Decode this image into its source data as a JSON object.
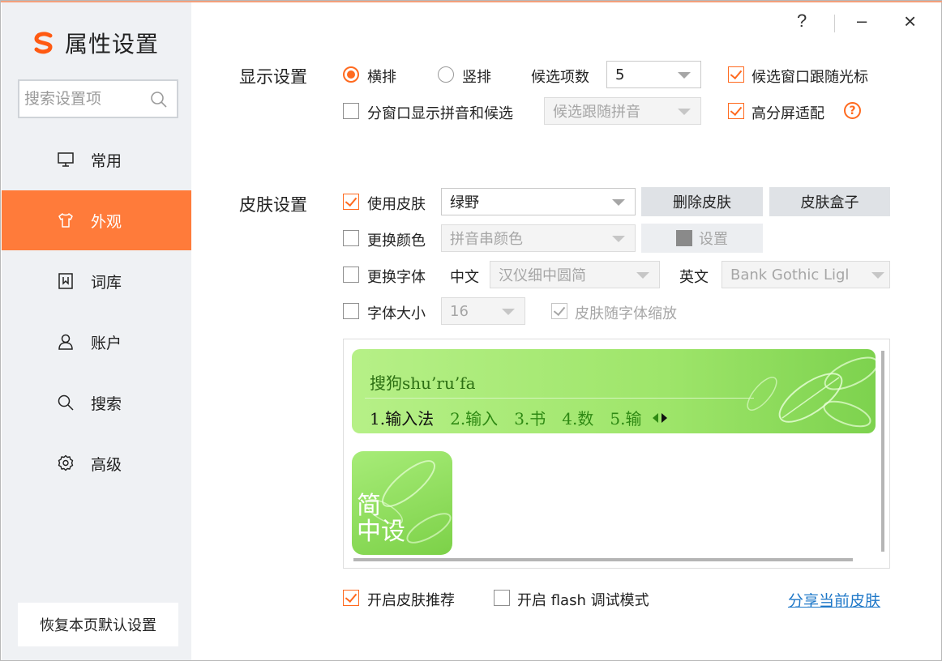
{
  "window": {
    "title": "属性设置",
    "controls": {
      "help": "?",
      "minimize": "–",
      "close": "×"
    }
  },
  "sidebar": {
    "search_placeholder": "搜索设置项",
    "items": [
      {
        "label": "常用",
        "icon": "monitor-icon",
        "active": false
      },
      {
        "label": "外观",
        "icon": "shirt-icon",
        "active": true
      },
      {
        "label": "词库",
        "icon": "dictionary-icon",
        "active": false
      },
      {
        "label": "账户",
        "icon": "user-icon",
        "active": false
      },
      {
        "label": "搜索",
        "icon": "search-icon",
        "active": false
      },
      {
        "label": "高级",
        "icon": "gear-icon",
        "active": false
      }
    ],
    "reset_label": "恢复本页默认设置"
  },
  "display": {
    "section_label": "显示设置",
    "horizontal_label": "横排",
    "horizontal_selected": true,
    "vertical_label": "竖排",
    "vertical_selected": false,
    "candidate_count_label": "候选项数",
    "candidate_count_value": "5",
    "follow_cursor_label": "候选窗口跟随光标",
    "follow_cursor_checked": true,
    "split_window_label": "分窗口显示拼音和候选",
    "split_window_checked": false,
    "split_window_select": "候选跟随拼音",
    "hidpi_label": "高分屏适配",
    "hidpi_checked": true
  },
  "skin": {
    "section_label": "皮肤设置",
    "use_skin_label": "使用皮肤",
    "use_skin_checked": true,
    "skin_value": "绿野",
    "delete_skin_label": "删除皮肤",
    "skin_box_label": "皮肤盒子",
    "change_color_label": "更换颜色",
    "change_color_checked": false,
    "color_select": "拼音串颜色",
    "color_set_label": "设置",
    "change_font_label": "更换字体",
    "change_font_checked": false,
    "chinese_label": "中文",
    "chinese_font": "汉仪细中圆简",
    "english_label": "英文",
    "english_font": "Bank Gothic Ligl",
    "font_size_label": "字体大小",
    "font_size_checked": false,
    "font_size_value": "16",
    "scale_with_font_label": "皮肤随字体缩放",
    "scale_with_font_checked": true
  },
  "preview": {
    "pinyin": "搜狗shu’ru’fa",
    "candidates": [
      "1.输入法",
      "2.输入",
      "3.书",
      "4.数",
      "5.输"
    ],
    "status_line1": "简",
    "status_line2": "中设"
  },
  "footer": {
    "recommend_label": "开启皮肤推荐",
    "recommend_checked": true,
    "flash_debug_label": "开启 flash 调试模式",
    "flash_debug_checked": false,
    "share_label": "分享当前皮肤"
  },
  "colors": {
    "accent": "#ff7b3a",
    "checkbox_accent": "#ff6a1f",
    "sidebar_bg": "#eff1f4",
    "link": "#1f78c8",
    "skin_green": "#9ee56a"
  }
}
